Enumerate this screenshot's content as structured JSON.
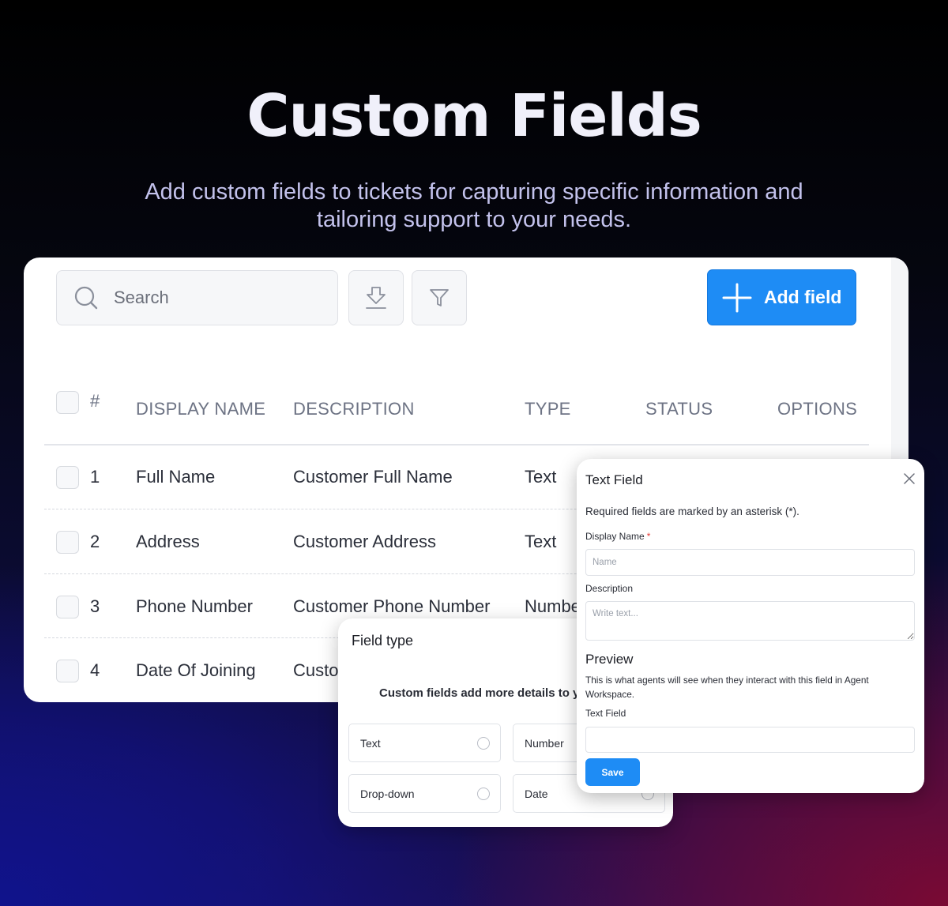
{
  "hero": {
    "title": "Custom Fields",
    "subtitle": "Add custom fields to tickets for capturing specific information and tailoring support to your needs."
  },
  "toolbar": {
    "search_placeholder": "Search",
    "export_icon": "download-icon",
    "filter_icon": "filter-icon",
    "add_label": "Add field",
    "accent": "#1e8cf5"
  },
  "table": {
    "headers": {
      "number": "#",
      "display_name": "DISPLAY NAME",
      "description": "DESCRIPTION",
      "type": "TYPE",
      "status": "STATUS",
      "options": "OPTIONS"
    },
    "rows": [
      {
        "num": "1",
        "name": "Full Name",
        "description": "Customer Full Name",
        "type": "Text"
      },
      {
        "num": "2",
        "name": "Address",
        "description": "Customer Address",
        "type": "Text"
      },
      {
        "num": "3",
        "name": "Phone Number",
        "description": "Customer Phone Number",
        "type": "Numbe"
      },
      {
        "num": "4",
        "name": "Date Of Joining",
        "description": "Custo",
        "type": ""
      }
    ]
  },
  "field_type_modal": {
    "title": "Field type",
    "description": "Custom fields add more details to y",
    "options": [
      "Text",
      "Number",
      "Drop-down",
      "Date"
    ]
  },
  "text_field_modal": {
    "title": "Text Field",
    "required_note": "Required fields are marked by an asterisk (*).",
    "display_name_label": "Display Name",
    "required_mark": "*",
    "display_name_placeholder": "Name",
    "description_label": "Description",
    "description_placeholder": "Write text...",
    "preview_heading": "Preview",
    "preview_description": "This is what agents will see when they interact with this field in Agent Workspace.",
    "preview_field_label": "Text Field",
    "save_label": "Save"
  }
}
